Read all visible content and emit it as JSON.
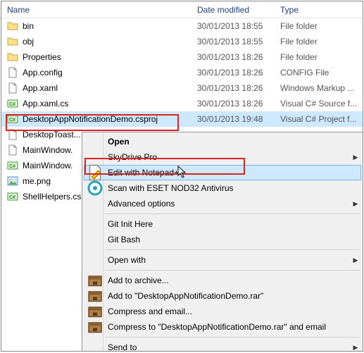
{
  "columns": {
    "name": "Name",
    "date": "Date modified",
    "type": "Type"
  },
  "files": [
    {
      "name": "bin",
      "date": "30/01/2013 18:55",
      "type": "File folder",
      "icon": "folder"
    },
    {
      "name": "obj",
      "date": "30/01/2013 18:55",
      "type": "File folder",
      "icon": "folder"
    },
    {
      "name": "Properties",
      "date": "30/01/2013 18:26",
      "type": "File folder",
      "icon": "folder"
    },
    {
      "name": "App.config",
      "date": "30/01/2013 18:26",
      "type": "CONFIG File",
      "icon": "file"
    },
    {
      "name": "App.xaml",
      "date": "30/01/2013 18:26",
      "type": "Windows Markup ...",
      "icon": "file"
    },
    {
      "name": "App.xaml.cs",
      "date": "30/01/2013 18:26",
      "type": "Visual C# Source f...",
      "icon": "cs"
    },
    {
      "name": "DesktopAppNotificationDemo.csproj",
      "date": "30/01/2013 19:48",
      "type": "Visual C# Project f...",
      "icon": "csproj",
      "selected": true
    },
    {
      "name": "DesktopToast...",
      "date": "",
      "type": "",
      "icon": "file"
    },
    {
      "name": "MainWindow.",
      "date": "",
      "type": "",
      "icon": "file"
    },
    {
      "name": "MainWindow.",
      "date": "",
      "type": "",
      "icon": "cs"
    },
    {
      "name": "me.png",
      "date": "",
      "type": "",
      "icon": "png"
    },
    {
      "name": "ShellHelpers.cs",
      "date": "",
      "type": "",
      "icon": "cs"
    }
  ],
  "menu": [
    {
      "label": "Open",
      "bold": true,
      "icon": ""
    },
    {
      "label": "SkyDrive Pro",
      "icon": "",
      "submenu": true
    },
    {
      "label": "Edit with Notepad++",
      "icon": "notepad",
      "hover": true
    },
    {
      "label": "Scan with ESET NOD32 Antivirus",
      "icon": "eset"
    },
    {
      "label": "Advanced options",
      "icon": "",
      "submenu": true
    },
    {
      "sep": true
    },
    {
      "label": "Git Init Here",
      "icon": ""
    },
    {
      "label": "Git Bash",
      "icon": ""
    },
    {
      "sep": true
    },
    {
      "label": "Open with",
      "icon": "",
      "submenu": true
    },
    {
      "sep": true
    },
    {
      "label": "Add to archive...",
      "icon": "rar"
    },
    {
      "label": "Add to \"DesktopAppNotificationDemo.rar\"",
      "icon": "rar"
    },
    {
      "label": "Compress and email...",
      "icon": "rar"
    },
    {
      "label": "Compress to \"DesktopAppNotificationDemo.rar\" and email",
      "icon": "rar"
    },
    {
      "sep": true
    },
    {
      "label": "Send to",
      "icon": "",
      "submenu": true
    }
  ]
}
